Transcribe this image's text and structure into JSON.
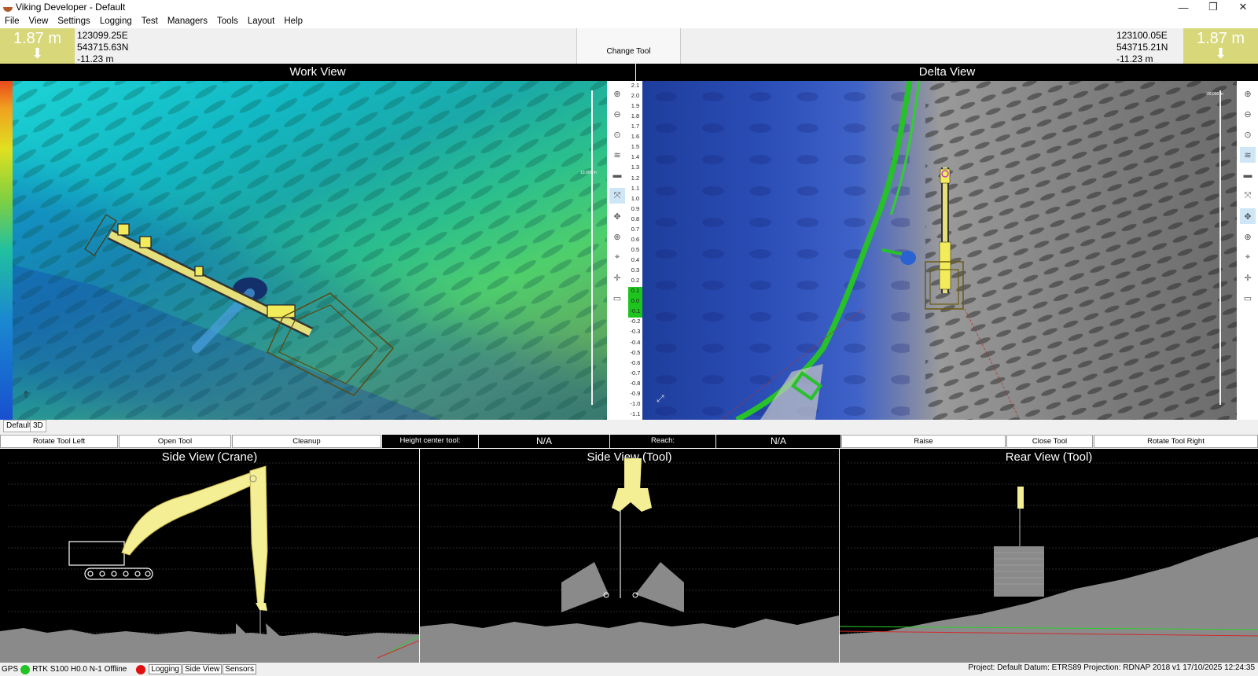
{
  "window": {
    "title": "Viking Developer - Default",
    "controls": {
      "minimize": "—",
      "restore": "❐",
      "close": "✕"
    }
  },
  "menu": [
    "File",
    "View",
    "Settings",
    "Logging",
    "Test",
    "Managers",
    "Tools",
    "Layout",
    "Help"
  ],
  "header": {
    "left": {
      "depth": "1.87 m",
      "easting": "123099.25E",
      "northing": "543715.63N",
      "height": "-11.23 m"
    },
    "right": {
      "depth": "1.87 m",
      "easting": "123100.05E",
      "northing": "543715.21N",
      "height": "-11.23 m"
    },
    "change_tool_label": "Change Tool",
    "depth_color": "#d8d77a"
  },
  "views": {
    "work_view_title": "Work View",
    "delta_view_title": "Delta View",
    "work_scale_label": "10,000 m",
    "delta_scale_label": "20,000 m",
    "delta_scale_ticks": [
      "2.1",
      "2.0",
      "1.9",
      "1.8",
      "1.7",
      "1.6",
      "1.5",
      "1.4",
      "1.3",
      "1.2",
      "1.1",
      "1.0",
      "0.9",
      "0.8",
      "0.7",
      "0.6",
      "0.5",
      "0.4",
      "0.3",
      "0.2",
      "0.1",
      "0.0",
      "-0.1",
      "-0.2",
      "-0.3",
      "-0.4",
      "-0.5",
      "-0.6",
      "-0.7",
      "-0.8",
      "-0.9",
      "-1.0",
      "-1.1"
    ]
  },
  "sidebar_tools": [
    "zoom-in-icon",
    "zoom-out-icon",
    "zoom-fit-icon",
    "layers-icon",
    "minus-icon",
    "fit-extent-icon",
    "center-icon",
    "crosshair-icon",
    "target-icon",
    "pointer-icon",
    "clear-icon"
  ],
  "map_tabs": [
    "Default",
    "3D"
  ],
  "controls": {
    "rotate_left": "Rotate Tool Left",
    "open_tool": "Open  Tool",
    "cleanup": "Cleanup",
    "height_center_label": "Height center tool:",
    "height_center_value": "N/A",
    "reach_label": "Reach:",
    "reach_value": "N/A",
    "raise": "Raise",
    "close_tool": "Close  Tool",
    "rotate_right": "Rotate Tool Right"
  },
  "bottom_views": {
    "crane_title": "Side View (Crane)",
    "tool_title": "Side View (Tool)",
    "rear_title": "Rear View (Tool)"
  },
  "status": {
    "gps_label": "GPS",
    "gps_status": "RTK S100 H0.0 N-1 Offline",
    "gps_color": "#22c322",
    "logging_color": "#e01010",
    "tabs": [
      "Logging",
      "Side View",
      "Sensors"
    ],
    "right_text": "Project: Default  Datum: ETRS89  Projection: RDNAP 2018 v1 17/10/2025 12:24:35"
  }
}
